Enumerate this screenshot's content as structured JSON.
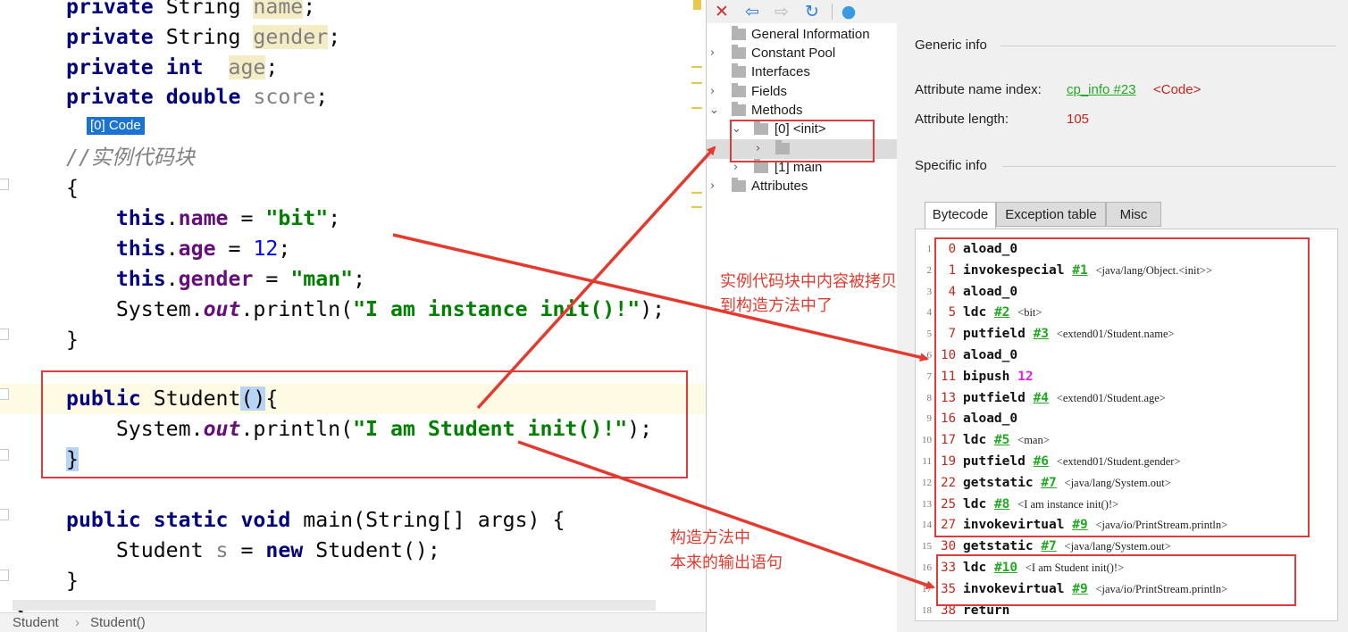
{
  "editor": {
    "lines": [
      {
        "segs": [
          {
            "t": "private ",
            "c": "kw"
          },
          {
            "t": "String "
          },
          {
            "t": "name",
            "c": "fld-dim hl-y"
          },
          {
            "t": ";"
          }
        ]
      },
      {
        "segs": [
          {
            "t": "private ",
            "c": "kw"
          },
          {
            "t": "String "
          },
          {
            "t": "gender",
            "c": "fld-dim hl-y"
          },
          {
            "t": ";"
          }
        ]
      },
      {
        "segs": [
          {
            "t": "private ",
            "c": "kw"
          },
          {
            "t": "int ",
            "c": "kw"
          },
          {
            "t": " "
          },
          {
            "t": "age",
            "c": "fld-dim hl-y"
          },
          {
            "t": ";"
          }
        ]
      },
      {
        "segs": [
          {
            "t": "private ",
            "c": "kw"
          },
          {
            "t": "double ",
            "c": "kw"
          },
          {
            "t": "score",
            "c": "fld-dim"
          },
          {
            "t": ";"
          }
        ]
      },
      {
        "segs": []
      },
      {
        "segs": [
          {
            "t": "//实例代码块",
            "c": "cmt"
          }
        ]
      },
      {
        "segs": [
          {
            "t": "{"
          }
        ]
      },
      {
        "segs": [
          {
            "t": "    "
          },
          {
            "t": "this",
            "c": "kw"
          },
          {
            "t": "."
          },
          {
            "t": "name",
            "c": "fld"
          },
          {
            "t": " = "
          },
          {
            "t": "\"bit\"",
            "c": "str"
          },
          {
            "t": ";"
          }
        ]
      },
      {
        "segs": [
          {
            "t": "    "
          },
          {
            "t": "this",
            "c": "kw"
          },
          {
            "t": "."
          },
          {
            "t": "age",
            "c": "fld"
          },
          {
            "t": " = "
          },
          {
            "t": "12",
            "c": "num"
          },
          {
            "t": ";"
          }
        ]
      },
      {
        "segs": [
          {
            "t": "    "
          },
          {
            "t": "this",
            "c": "kw"
          },
          {
            "t": "."
          },
          {
            "t": "gender",
            "c": "fld"
          },
          {
            "t": " = "
          },
          {
            "t": "\"man\"",
            "c": "str"
          },
          {
            "t": ";"
          }
        ]
      },
      {
        "segs": [
          {
            "t": "    System."
          },
          {
            "t": "out",
            "c": "stat"
          },
          {
            "t": ".println("
          },
          {
            "t": "\"I am instance init()!\"",
            "c": "str"
          },
          {
            "t": ");"
          }
        ]
      },
      {
        "segs": [
          {
            "t": "}"
          }
        ]
      },
      {
        "segs": []
      },
      {
        "segs": [
          {
            "t": "public ",
            "c": "kw"
          },
          {
            "t": "Student"
          },
          {
            "t": "()",
            "c": "hl-b"
          },
          {
            "t": "{"
          }
        ]
      },
      {
        "segs": [
          {
            "t": "    System."
          },
          {
            "t": "out",
            "c": "stat"
          },
          {
            "t": ".println("
          },
          {
            "t": "\"I am Student init()!\"",
            "c": "str"
          },
          {
            "t": ");"
          }
        ]
      },
      {
        "segs": [
          {
            "t": "}",
            "c": "hl-b"
          }
        ]
      },
      {
        "segs": []
      },
      {
        "segs": [
          {
            "t": "public ",
            "c": "kw"
          },
          {
            "t": "static ",
            "c": "kw"
          },
          {
            "t": "void ",
            "c": "kw"
          },
          {
            "t": "main(String[] args) {"
          }
        ]
      },
      {
        "segs": [
          {
            "t": "    Student "
          },
          {
            "t": "s",
            "c": "fld-dim"
          },
          {
            "t": " = "
          },
          {
            "t": "new ",
            "c": "kw"
          },
          {
            "t": "Student();"
          }
        ]
      },
      {
        "segs": [
          {
            "t": "}"
          }
        ]
      },
      {
        "segs": [
          {
            "t": "}"
          }
        ]
      }
    ]
  },
  "breadcrumb": {
    "class_name": "Student",
    "sep": "›",
    "method_name": "Student()"
  },
  "toolbar": {
    "close": "✕",
    "back": "⇦",
    "forward": "⇨",
    "refresh": "↻",
    "web": "●"
  },
  "tree": {
    "general": "General Information",
    "constant_pool": "Constant Pool",
    "interfaces": "Interfaces",
    "fields": "Fields",
    "methods": "Methods",
    "init": "[0] <init>",
    "code": "[0] Code",
    "main": "[1] main",
    "attributes": "Attributes"
  },
  "info": {
    "generic_title": "Generic info",
    "attr_name_label": "Attribute name index:",
    "attr_name_link": "cp_info #23",
    "attr_name_value": "<Code>",
    "attr_len_label": "Attribute length:",
    "attr_len_value": "105",
    "specific_title": "Specific info"
  },
  "tabs": [
    "Bytecode",
    "Exception table",
    "Misc"
  ],
  "bytecode": [
    {
      "ln": "1",
      "off": "0",
      "op": "aload_0",
      "arg": "",
      "cm": ""
    },
    {
      "ln": "2",
      "off": "1",
      "op": "invokespecial",
      "arg": "#1",
      "cm": "<java/lang/Object.<init>>"
    },
    {
      "ln": "3",
      "off": "4",
      "op": "aload_0",
      "arg": "",
      "cm": ""
    },
    {
      "ln": "4",
      "off": "5",
      "op": "ldc",
      "arg": "#2",
      "cm": "<bit>"
    },
    {
      "ln": "5",
      "off": "7",
      "op": "putfield",
      "arg": "#3",
      "cm": "<extend01/Student.name>"
    },
    {
      "ln": "6",
      "off": "10",
      "op": "aload_0",
      "arg": "",
      "cm": ""
    },
    {
      "ln": "7",
      "off": "11",
      "op": "bipush",
      "num": "12",
      "cm": ""
    },
    {
      "ln": "8",
      "off": "13",
      "op": "putfield",
      "arg": "#4",
      "cm": "<extend01/Student.age>"
    },
    {
      "ln": "9",
      "off": "16",
      "op": "aload_0",
      "arg": "",
      "cm": ""
    },
    {
      "ln": "10",
      "off": "17",
      "op": "ldc",
      "arg": "#5",
      "cm": "<man>"
    },
    {
      "ln": "11",
      "off": "19",
      "op": "putfield",
      "arg": "#6",
      "cm": "<extend01/Student.gender>"
    },
    {
      "ln": "12",
      "off": "22",
      "op": "getstatic",
      "arg": "#7",
      "cm": "<java/lang/System.out>"
    },
    {
      "ln": "13",
      "off": "25",
      "op": "ldc",
      "arg": "#8",
      "cm": "<I am instance init()!>"
    },
    {
      "ln": "14",
      "off": "27",
      "op": "invokevirtual",
      "arg": "#9",
      "cm": "<java/io/PrintStream.println>"
    },
    {
      "ln": "15",
      "off": "30",
      "op": "getstatic",
      "arg": "#7",
      "cm": "<java/lang/System.out>"
    },
    {
      "ln": "16",
      "off": "33",
      "op": "ldc",
      "arg": "#10",
      "cm": "<I am Student init()!>"
    },
    {
      "ln": "17",
      "off": "35",
      "op": "invokevirtual",
      "arg": "#9",
      "cm": "<java/io/PrintStream.println>"
    },
    {
      "ln": "18",
      "off": "38",
      "op": "return",
      "arg": "",
      "cm": ""
    }
  ],
  "annotations": {
    "copy_line1": "实例代码块中内容被拷贝",
    "copy_line2": "到构造方法中了",
    "ctor_line1": "构造方法中",
    "ctor_line2": "本来的输出语句"
  },
  "colors": {
    "accent_red": "#e0393e",
    "link_green": "#22a822",
    "keyword": "#000080",
    "field": "#660e7a",
    "string": "#008000"
  }
}
